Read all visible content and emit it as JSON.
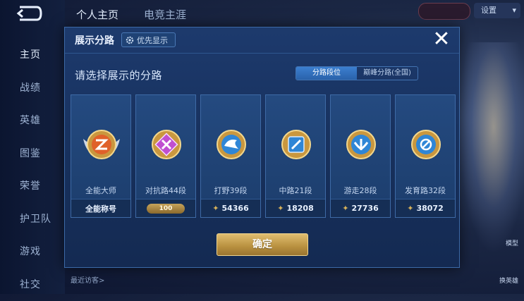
{
  "background": {
    "top_tabs": [
      "个人主页",
      "电竞主涯"
    ],
    "side_nav": [
      {
        "label": "主页",
        "active": true
      },
      {
        "label": "战绩",
        "active": false
      },
      {
        "label": "英雄",
        "active": false
      },
      {
        "label": "图鉴",
        "active": false
      },
      {
        "label": "荣誉",
        "active": false
      },
      {
        "label": "护卫队",
        "active": false
      },
      {
        "label": "游戏",
        "active": false
      },
      {
        "label": "社交",
        "active": false
      }
    ],
    "top_right_btn": "设置",
    "top_right_pill": "",
    "bottom_text": "最近访客>",
    "right_labels": [
      "模型",
      "换英雄"
    ]
  },
  "modal": {
    "title": "展示分路",
    "priority_label": "优先显示",
    "subtitle": "请选择展示的分路",
    "tabs": [
      {
        "label": "分路段位",
        "active": true
      },
      {
        "label": "巅峰分路(全国)",
        "active": false
      }
    ],
    "close_icon": "close-icon",
    "cards": [
      {
        "name": "全能大师",
        "footer_text": "全能称号",
        "footer_type": "text",
        "color": "#e0612a",
        "icon": "all-round-emblem-icon"
      },
      {
        "name": "对抗路44段",
        "footer_text": "100",
        "footer_type": "badge",
        "color": "#c04fd0",
        "icon": "clash-lane-emblem-icon"
      },
      {
        "name": "打野39段",
        "footer_text": "54366",
        "footer_type": "score",
        "color": "#2f86d6",
        "icon": "jungle-emblem-icon"
      },
      {
        "name": "中路21段",
        "footer_text": "18208",
        "footer_type": "score",
        "color": "#2f86d6",
        "icon": "mid-lane-emblem-icon"
      },
      {
        "name": "游走28段",
        "footer_text": "27736",
        "footer_type": "score",
        "color": "#2f86d6",
        "icon": "roam-emblem-icon"
      },
      {
        "name": "发育路32段",
        "footer_text": "38072",
        "footer_type": "score",
        "color": "#2f86d6",
        "icon": "farm-lane-emblem-icon"
      }
    ],
    "confirm_label": "确定"
  }
}
